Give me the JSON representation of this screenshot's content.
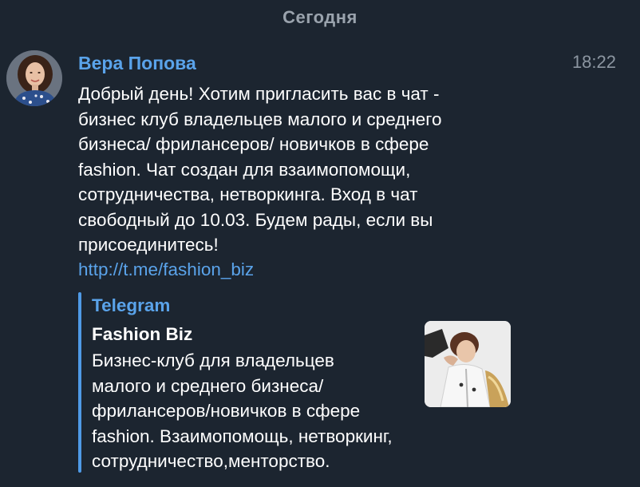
{
  "date_separator": "Сегодня",
  "message": {
    "sender": "Вера Попова",
    "time": "18:22",
    "text": "Добрый день! Хотим пригласить вас в чат -\nбизнес клуб владельцев малого и среднего\nбизнеса/ фрилансеров/ новичков в сфере\nfashion. Чат создан для взаимопомощи,\nсотрудничества, нетворкинга. Вход в чат\nсвободный до 10.03. Будем рады, если вы\nприсоединитесь!",
    "link": "http://t.me/fashion_biz"
  },
  "link_preview": {
    "site_name": "Telegram",
    "title": "Fashion Biz",
    "description": "Бизнес-клуб для владельцев\nмалого и среднего бизнеса/\nфрилансеров/новичков в сфере\nfashion. Взаимопомощь, нетворкинг,\nсотрудничество,менторство."
  },
  "colors": {
    "background": "#1c2530",
    "accent": "#5aa3ea",
    "preview_bar": "#4f9ae6",
    "muted_text": "#8c96a1"
  }
}
